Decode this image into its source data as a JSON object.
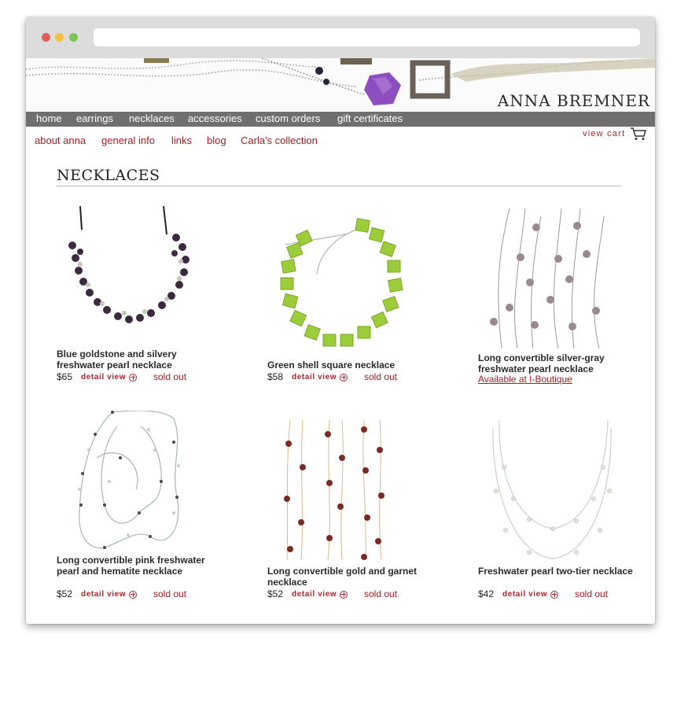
{
  "brand": {
    "name": "ANNA BREMNER"
  },
  "main_nav": [
    {
      "label": "home"
    },
    {
      "label": "earrings"
    },
    {
      "label": "necklaces"
    },
    {
      "label": "accessories"
    },
    {
      "label": "custom orders"
    },
    {
      "label": "gift certificates"
    }
  ],
  "sub_nav": [
    {
      "label": "about anna"
    },
    {
      "label": "general info"
    },
    {
      "label": "links"
    },
    {
      "label": "blog"
    },
    {
      "label": "Carla's collection"
    }
  ],
  "cart": {
    "label": "view cart",
    "icon": "cart-icon"
  },
  "page": {
    "title": "NECKLACES"
  },
  "products": [
    {
      "name": "Blue goldstone and silvery freshwater pearl necklace",
      "price": "$65",
      "detail_label": "detail view",
      "status": "sold out"
    },
    {
      "name": "Green shell square necklace",
      "price": "$58",
      "detail_label": "detail view",
      "status": "sold out"
    },
    {
      "name": "Long convertible silver-gray freshwater pearl necklace",
      "link": "Available at I-Boutique"
    },
    {
      "name": "Long convertible pink freshwater pearl and hematite necklace",
      "price": "$52",
      "detail_label": "detail view",
      "status": "sold out"
    },
    {
      "name": "Long convertible gold and garnet necklace",
      "price": "$52",
      "detail_label": "detail view",
      "status": "sold out"
    },
    {
      "name": "Freshwater pearl two-tier necklace",
      "price": "$42",
      "detail_label": "detail view",
      "status": "sold out"
    }
  ],
  "colors": {
    "accent": "#a41e22",
    "nav_bg": "#6f6f6f",
    "title": "#222222"
  }
}
